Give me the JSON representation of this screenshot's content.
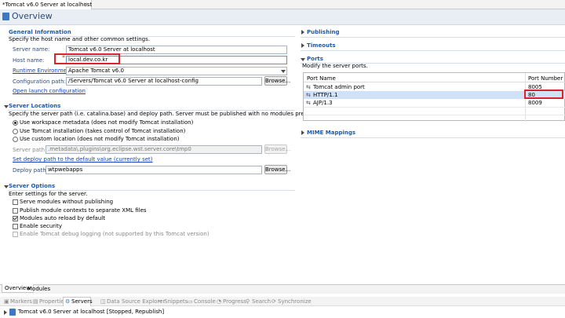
{
  "editor_tab": {
    "title": "*Tomcat v6.0 Server at localhost"
  },
  "overview": {
    "title": "Overview"
  },
  "general": {
    "title": "General Information",
    "desc": "Specify the host name and other common settings.",
    "server_name_label": "Server name:",
    "server_name_value": "Tomcat v6.0 Server at localhost",
    "host_name_label": "Host name:",
    "host_name_value": "local.dev.co.kr",
    "runtime_label": "Runtime Environment:",
    "runtime_value": "Apache Tomcat v6.0",
    "config_label": "Configuration path:",
    "config_value": "/Servers/Tomcat v6.0 Server at localhost-config",
    "browse": "Browse...",
    "open_launch": "Open launch configuration"
  },
  "locations": {
    "title": "Server Locations",
    "desc": "Specify the server path (i.e. catalina.base) and deploy path. Server must be published with no modules present to make changes.",
    "options": [
      "Use workspace metadata (does not modify Tomcat installation)",
      "Use Tomcat installation (takes control of Tomcat installation)",
      "Use custom location (does not modify Tomcat installation)"
    ],
    "server_path_label": "Server path:",
    "server_path_value": ".metadata\\.plugins\\org.eclipse.wst.server.core\\tmp0",
    "browse": "Browse...",
    "set_default": "Set deploy path to the default value (currently set)",
    "deploy_label": "Deploy path:",
    "deploy_value": "wtpwebapps"
  },
  "options": {
    "title": "Server Options",
    "desc": "Enter settings for the server.",
    "items": [
      "Serve modules without publishing",
      "Publish module contexts to separate XML files",
      "Modules auto reload by default",
      "Enable security",
      "Enable Tomcat debug logging (not supported by this Tomcat version)"
    ]
  },
  "right": {
    "publishing": "Publishing",
    "timeouts": "Timeouts",
    "ports": "Ports",
    "ports_desc": "Modify the server ports.",
    "col_name": "Port Name",
    "col_number": "Port Number",
    "rows": [
      {
        "name": "Tomcat admin port",
        "number": "8005"
      },
      {
        "name": "HTTP/1.1",
        "number": "80"
      },
      {
        "name": "AJP/1.3",
        "number": "8009"
      }
    ],
    "mime": "MIME Mappings"
  },
  "bottom_tabs": {
    "overview": "Overview",
    "modules": "Modules"
  },
  "views": {
    "markers": "Markers",
    "properties": "Properties",
    "servers": "Servers",
    "dse": "Data Source Explorer",
    "snippets": "Snippets",
    "console": "Console",
    "progress": "Progress",
    "search": "Search",
    "sync": "Synchronize"
  },
  "server_entry": "Tomcat v6.0 Server at localhost  [Stopped, Republish]"
}
